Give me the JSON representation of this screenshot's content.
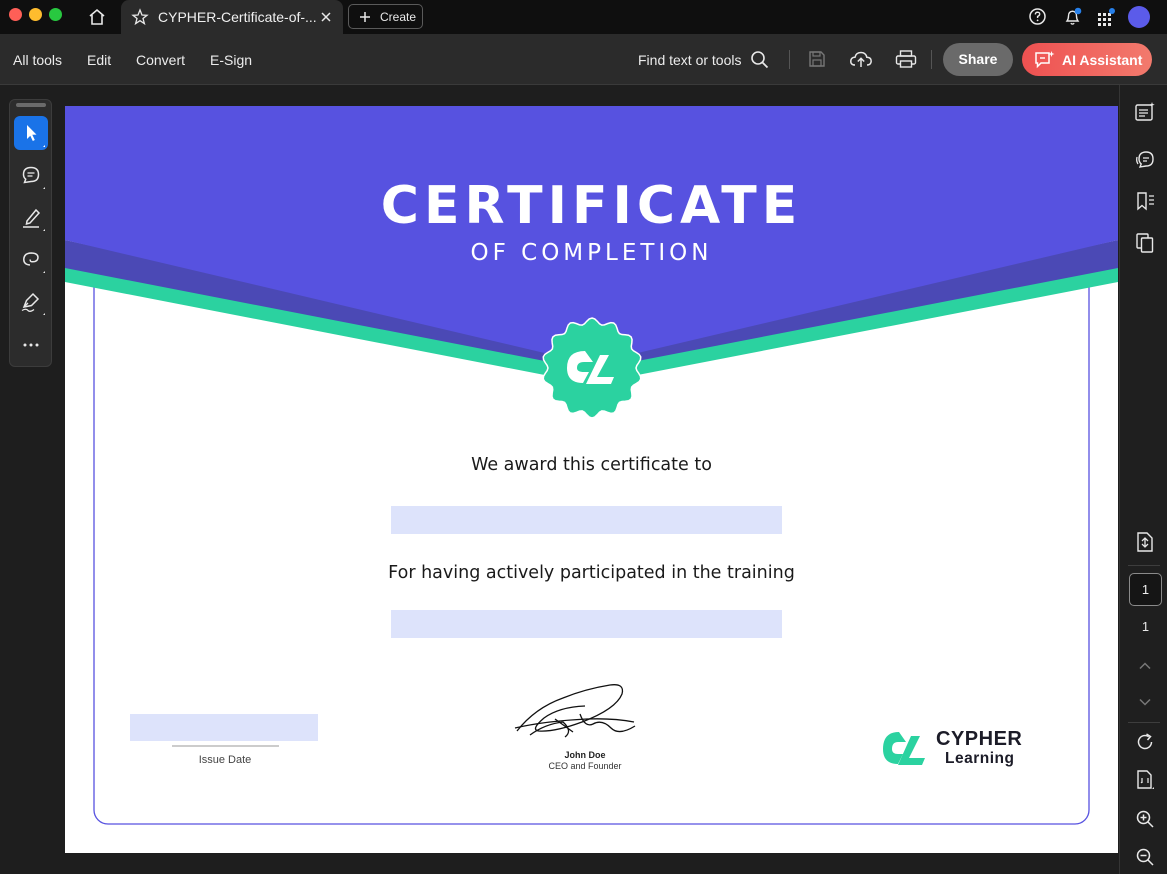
{
  "window": {
    "tab_title": "CYPHER-Certificate-of-...",
    "create_label": "Create"
  },
  "menubar": {
    "items": [
      "All tools",
      "Edit",
      "Convert",
      "E-Sign"
    ],
    "find_label": "Find text or tools",
    "share_label": "Share",
    "ai_label": "AI Assistant"
  },
  "colors": {
    "accent_blue": "#1a73e8",
    "certificate_purple": "#5752e0",
    "certificate_teal": "#2bd2a0",
    "ai_gradient_start": "#ee5151",
    "field_fill": "#dde3fb"
  },
  "left_tools": [
    {
      "icon": "select-arrow-icon",
      "active": true
    },
    {
      "icon": "comment-icon",
      "active": false
    },
    {
      "icon": "highlighter-icon",
      "active": false
    },
    {
      "icon": "lasso-draw-icon",
      "active": false
    },
    {
      "icon": "sign-pen-icon",
      "active": false
    },
    {
      "icon": "more-icon",
      "active": false
    }
  ],
  "certificate": {
    "title": "CERTIFICATE",
    "subtitle": "OF COMPLETION",
    "award_text": "We award this certificate to",
    "participation_text": "For having actively participated in the training",
    "issue_date_label": "Issue Date",
    "signer_name": "John Doe",
    "signer_role": "CEO and Founder",
    "logo_line1": "CYPHER",
    "logo_line2": "Learning"
  },
  "pagination": {
    "current_page": "1",
    "total_pages": "1"
  }
}
